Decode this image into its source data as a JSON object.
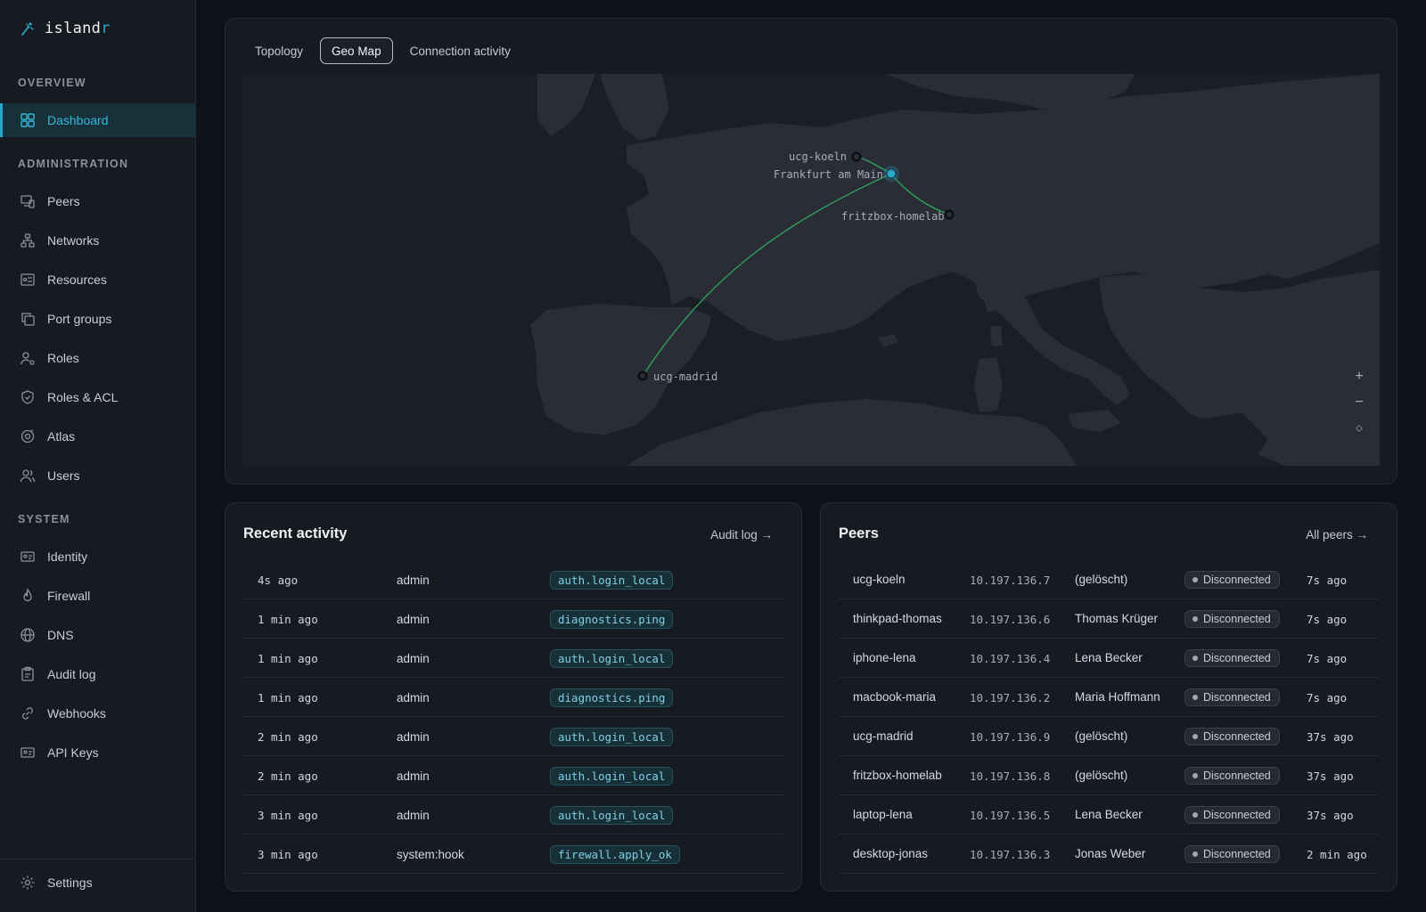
{
  "app": {
    "logo_text": "island",
    "logo_accent": "r"
  },
  "sidebar": {
    "overview_title": "OVERVIEW",
    "admin_title": "ADMINISTRATION",
    "system_title": "SYSTEM",
    "dashboard": "Dashboard",
    "peers": "Peers",
    "networks": "Networks",
    "resources": "Resources",
    "port_groups": "Port groups",
    "roles": "Roles",
    "roles_acl": "Roles & ACL",
    "atlas": "Atlas",
    "users": "Users",
    "identity": "Identity",
    "firewall": "Firewall",
    "dns": "DNS",
    "audit_log": "Audit log",
    "webhooks": "Webhooks",
    "api_keys": "API Keys",
    "settings": "Settings"
  },
  "map": {
    "tabs": [
      "Topology",
      "Geo Map",
      "Connection activity"
    ],
    "active_tab": "Geo Map",
    "nodes": {
      "koeln": "ucg-koeln",
      "frankfurt": "Frankfurt am Main",
      "fritzbox": "fritzbox-homelab",
      "madrid": "ucg-madrid"
    },
    "zoom_in": "+",
    "zoom_out": "−",
    "reset": "⬦"
  },
  "activity": {
    "title": "Recent activity",
    "link": "Audit log →",
    "rows": [
      {
        "time": "4s ago",
        "actor": "admin",
        "event": "auth.login_local"
      },
      {
        "time": "1 min ago",
        "actor": "admin",
        "event": "diagnostics.ping"
      },
      {
        "time": "1 min ago",
        "actor": "admin",
        "event": "auth.login_local"
      },
      {
        "time": "1 min ago",
        "actor": "admin",
        "event": "diagnostics.ping"
      },
      {
        "time": "2 min ago",
        "actor": "admin",
        "event": "auth.login_local"
      },
      {
        "time": "2 min ago",
        "actor": "admin",
        "event": "auth.login_local"
      },
      {
        "time": "3 min ago",
        "actor": "admin",
        "event": "auth.login_local"
      },
      {
        "time": "3 min ago",
        "actor": "system:hook",
        "event": "firewall.apply_ok"
      }
    ]
  },
  "peers": {
    "title": "Peers",
    "link": "All peers →",
    "rows": [
      {
        "name": "ucg-koeln",
        "ip": "10.197.136.7",
        "owner": "(gelöscht)",
        "status": "Disconnected",
        "seen": "7s ago"
      },
      {
        "name": "thinkpad-thomas",
        "ip": "10.197.136.6",
        "owner": "Thomas Krüger",
        "status": "Disconnected",
        "seen": "7s ago"
      },
      {
        "name": "iphone-lena",
        "ip": "10.197.136.4",
        "owner": "Lena Becker",
        "status": "Disconnected",
        "seen": "7s ago"
      },
      {
        "name": "macbook-maria",
        "ip": "10.197.136.2",
        "owner": "Maria Hoffmann",
        "status": "Disconnected",
        "seen": "7s ago"
      },
      {
        "name": "ucg-madrid",
        "ip": "10.197.136.9",
        "owner": "(gelöscht)",
        "status": "Disconnected",
        "seen": "37s ago"
      },
      {
        "name": "fritzbox-homelab",
        "ip": "10.197.136.8",
        "owner": "(gelöscht)",
        "status": "Disconnected",
        "seen": "37s ago"
      },
      {
        "name": "laptop-lena",
        "ip": "10.197.136.5",
        "owner": "Lena Becker",
        "status": "Disconnected",
        "seen": "37s ago"
      },
      {
        "name": "desktop-jonas",
        "ip": "10.197.136.3",
        "owner": "Jonas Weber",
        "status": "Disconnected",
        "seen": "2 min ago"
      }
    ]
  },
  "colors": {
    "accent": "#2aa7c9",
    "link_line": "#2f9e5e",
    "land": "#2a2d36",
    "sea": "#1b1e25"
  }
}
